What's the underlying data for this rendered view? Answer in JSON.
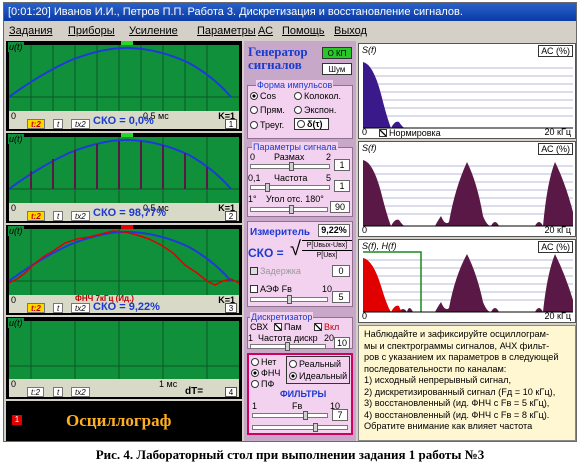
{
  "window": {
    "title": "[0:01:20] Иванов И.И., Петров П.П.  Работа 3. Дискретизация и восстановление сигналов."
  },
  "menu": [
    "Задания",
    "Приборы",
    "Усиление",
    "Параметры",
    "АС",
    "Помощь",
    "Выход"
  ],
  "oscilloscope": {
    "title": "Осциллограф",
    "y_label": "u(t)",
    "x_start": "0",
    "x_mid": "0,5 мс",
    "x_mid_last": "1 мс",
    "dt_label": "dT=",
    "time_buttons": [
      "t:2",
      "t",
      "tx2"
    ],
    "channels": [
      {
        "sko": "СКО = 0,0%",
        "k": "K=1",
        "num": "1"
      },
      {
        "sko": "СКО = 98,77%",
        "k": "K=1",
        "num": "2"
      },
      {
        "sko": "СКО = 9,22%",
        "k": "K=1",
        "num": "3",
        "filter_label": "ФНЧ 7кГц (Ид.)"
      },
      {
        "sko": "",
        "k": "K=1",
        "num": "4"
      }
    ]
  },
  "generator": {
    "title_line1": "Генератор",
    "title_line2": "сигналов",
    "kp_button": "О КП",
    "noise_button": "Шум",
    "pulse_shape": {
      "title": "Форма импульсов",
      "options": [
        "Cos",
        "Колокол.",
        "Прям.",
        "Экспон.",
        "Треуг.",
        "δ(τ)"
      ],
      "selected": "Cos"
    },
    "params": {
      "title": "Параметры сигнала",
      "range_label": "Размах",
      "range_min": "0",
      "range_max": "2",
      "range_value": "1",
      "freq_label": "Частота",
      "freq_min": "0,1",
      "freq_max": "5",
      "freq_value": "1",
      "angle_label": "Угол отс. 180°",
      "angle_min": "1°",
      "angle_value": "90"
    },
    "meter": {
      "label": "Измеритель",
      "value": "9,22%",
      "sko": "СКО =",
      "formula_num": "P[Uвых-Uвх]",
      "formula_den": "P[Uвх]",
      "delay_label": "Задержка",
      "delay_value": "0",
      "aef_label": "АЭФ Fв",
      "aef_max": "10",
      "aef_value": "5"
    },
    "sampler": {
      "title": "Дискретизатор",
      "svh_label": "СВХ",
      "pam_label": "Пам",
      "vkl_label": "Вкл",
      "freq_label": "Частота дискр",
      "freq_min": "1",
      "freq_max": "20",
      "freq_value": "10"
    },
    "filters": {
      "options": [
        "Нет",
        "ФНЧ",
        "ПФ"
      ],
      "selected": "ФНЧ",
      "mode_options": [
        "Реальный",
        "Идеальный"
      ],
      "mode_selected": "Идеальный",
      "title": "ФИЛЬТРЫ",
      "fv_label": "Fв",
      "fv_min": "1",
      "fv_max": "10",
      "fv_value": "7"
    }
  },
  "spectrum": {
    "panels": [
      {
        "label": "S(f)",
        "ac": "АС (%)",
        "k0": "0",
        "k20": "20 кГц",
        "normalize": "Нормировка"
      },
      {
        "label": "S(f)",
        "ac": "АС (%)",
        "k0": "0",
        "k20": "20 кГц"
      },
      {
        "label": "S(f), H(f)",
        "ac": "АС (%)",
        "k0": "0",
        "k20": "20 кГц"
      }
    ]
  },
  "instructions": {
    "lines": [
      "Наблюдайте и зафиксируйте осциллограм-",
      "мы и спектрограммы сигналов, АЧХ фильт-",
      "ров с указанием их параметров в следующей",
      "последовательности по каналам:",
      "1) исходный непрерывный сигнал,",
      "2) дискретизированный сигнал (Fд = 10 кГц),",
      "3) восстановленный (ид. ФНЧ с Fв = 5 кГц),",
      "4) восстановленный (ид. ФНЧ с Fв = 8 кГц).",
      "    Обратите внимание как влияет частота"
    ]
  },
  "caption": "Рис. 4. Лабораторный стол при выполнении задания 1 работы №3",
  "colors": {
    "screen": "#10903a",
    "trace": "#1e3adc",
    "spectrum": "#5a1846",
    "accent_red": "#e00000"
  }
}
